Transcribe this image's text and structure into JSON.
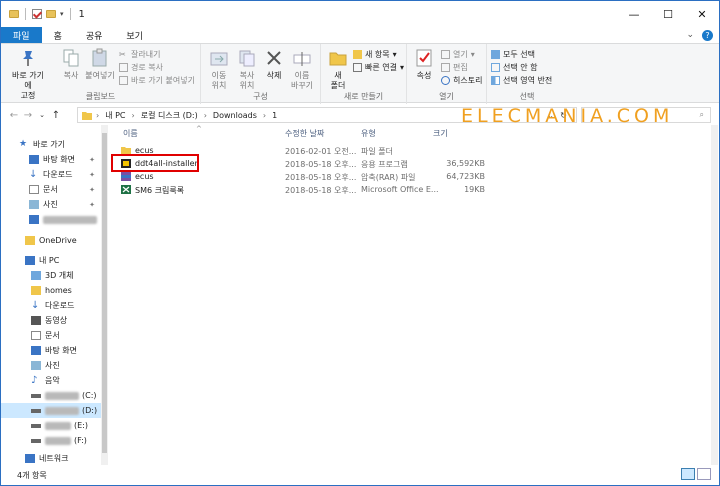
{
  "window": {
    "title": "1"
  },
  "ribbon": {
    "tabs": [
      {
        "label": "파일"
      },
      {
        "label": "홈"
      },
      {
        "label": "공유"
      },
      {
        "label": "보기"
      }
    ],
    "clipboard": {
      "label": "클립보드",
      "pin": "바로 가기에\n고정",
      "copy": "복사",
      "paste": "붙여넣기",
      "cut": "잘라내기",
      "copy_path": "경로 복사",
      "paste_shortcut": "바로 가기 붙여넣기"
    },
    "organize": {
      "label": "구성",
      "move_to": "이동\n위치",
      "copy_to": "복사\n위치",
      "delete": "삭제",
      "rename": "이름\n바꾸기"
    },
    "new": {
      "label": "새로 만들기",
      "new_folder": "새\n폴더",
      "new_item": "새 항목",
      "easy_access": "빠른 연결"
    },
    "open": {
      "label": "열기",
      "properties": "속성",
      "open": "열기",
      "edit": "편집",
      "history": "히스토리"
    },
    "select": {
      "label": "선택",
      "select_all": "모두 선택",
      "select_none": "선택 안 함",
      "invert": "선택 영역 반전"
    }
  },
  "address": {
    "crumbs": [
      "내 PC",
      "로컬 디스크 (D:)",
      "Downloads",
      "1"
    ]
  },
  "nav": {
    "quick_access": "바로 가기",
    "items": [
      {
        "label": "바탕 화면",
        "icon": "desktop-icon"
      },
      {
        "label": "다운로드",
        "icon": "download-icon"
      },
      {
        "label": "문서",
        "icon": "document-icon"
      },
      {
        "label": "사진",
        "icon": "pictures-icon"
      }
    ],
    "onedrive": "OneDrive",
    "this_pc": "내 PC",
    "pc_items": [
      {
        "label": "3D 개체",
        "icon": "3d-objects-icon"
      },
      {
        "label": "homes",
        "icon": "folder-icon"
      },
      {
        "label": "다운로드",
        "icon": "download-icon"
      },
      {
        "label": "동영상",
        "icon": "video-icon"
      },
      {
        "label": "문서",
        "icon": "document-icon"
      },
      {
        "label": "바탕 화면",
        "icon": "desktop-icon"
      },
      {
        "label": "사진",
        "icon": "pictures-icon"
      },
      {
        "label": "음악",
        "icon": "music-icon"
      }
    ],
    "drives": [
      {
        "label": "(C:)"
      },
      {
        "label": "(D:)"
      },
      {
        "label": "(E:)"
      },
      {
        "label": "(F:)"
      }
    ],
    "network": "네트워크"
  },
  "columns": {
    "name": "이름",
    "modified": "수정한 날짜",
    "type": "유형",
    "size": "크기"
  },
  "files": [
    {
      "name": "ecus",
      "modified": "2016-02-01 오전...",
      "type": "파일 폴더",
      "size": "",
      "icon": "folder-icon"
    },
    {
      "name": "ddt4all-installer",
      "modified": "2018-05-18 오후...",
      "type": "응용 프로그램",
      "size": "36,592KB",
      "icon": "application-icon"
    },
    {
      "name": "ecus",
      "modified": "2018-05-18 오후...",
      "type": "압축(RAR) 파일",
      "size": "64,723KB",
      "icon": "rar-archive-icon"
    },
    {
      "name": "SM6 크림룩록",
      "modified": "2018-05-18 오후...",
      "type": "Microsoft Office E...",
      "size": "19KB",
      "icon": "excel-icon"
    }
  ],
  "watermark": "ELECMANIA.COM",
  "status": {
    "count": "4개 항목"
  },
  "colors": {
    "file_tab": "#1979ca",
    "selection": "#cce8ff",
    "highlight_box": "#e00000",
    "watermark": "#f0a020"
  }
}
